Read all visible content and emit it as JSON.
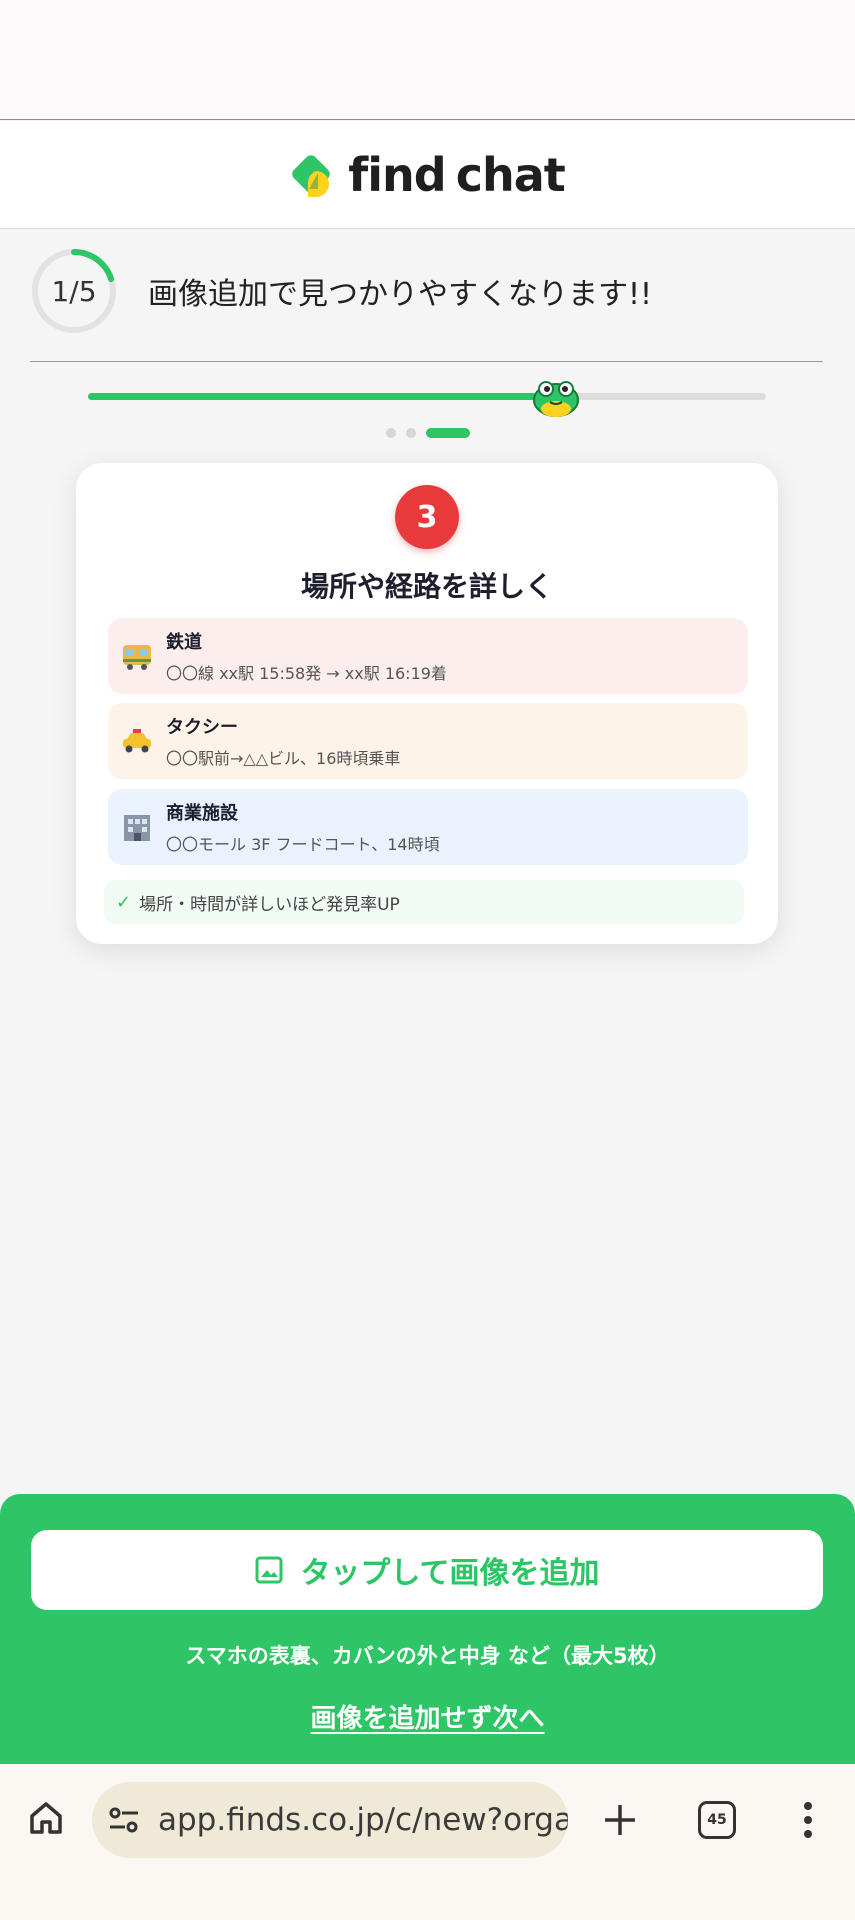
{
  "app": {
    "logo_text": "find chat",
    "logo_word1": "find",
    "logo_word2": "chat"
  },
  "progress": {
    "step_label": "1/5",
    "step_fraction": 0.2,
    "title": "画像追加で見つかりやすくなります!!",
    "slider_fraction": 0.69,
    "dots_total": 3,
    "dots_active": 3
  },
  "card": {
    "badge": "3",
    "title": "場所や経路を詳しく",
    "items": [
      {
        "icon": "train-icon",
        "name": "鉄道",
        "desc": "〇〇線 xx駅 15:58発 → xx駅 16:19着"
      },
      {
        "icon": "taxi-icon",
        "name": "タクシー",
        "desc": "〇〇駅前→△△ビル、16時頃乗車"
      },
      {
        "icon": "building-icon",
        "name": "商業施設",
        "desc": "〇〇モール 3F フードコート、14時頃"
      }
    ],
    "tip": "場所・時間が詳しいほど発見率UP"
  },
  "actions": {
    "add_button": "タップして画像を追加",
    "hint": "スマホの表裏、カバンの外と中身 など（最大5枚）",
    "skip_link": "画像を追加せず次へ"
  },
  "browser": {
    "url": "app.finds.co.jp/c/new?orga",
    "tab_count": "45"
  },
  "colors": {
    "brand_green": "#2ec566",
    "badge_red": "#e8393b"
  }
}
